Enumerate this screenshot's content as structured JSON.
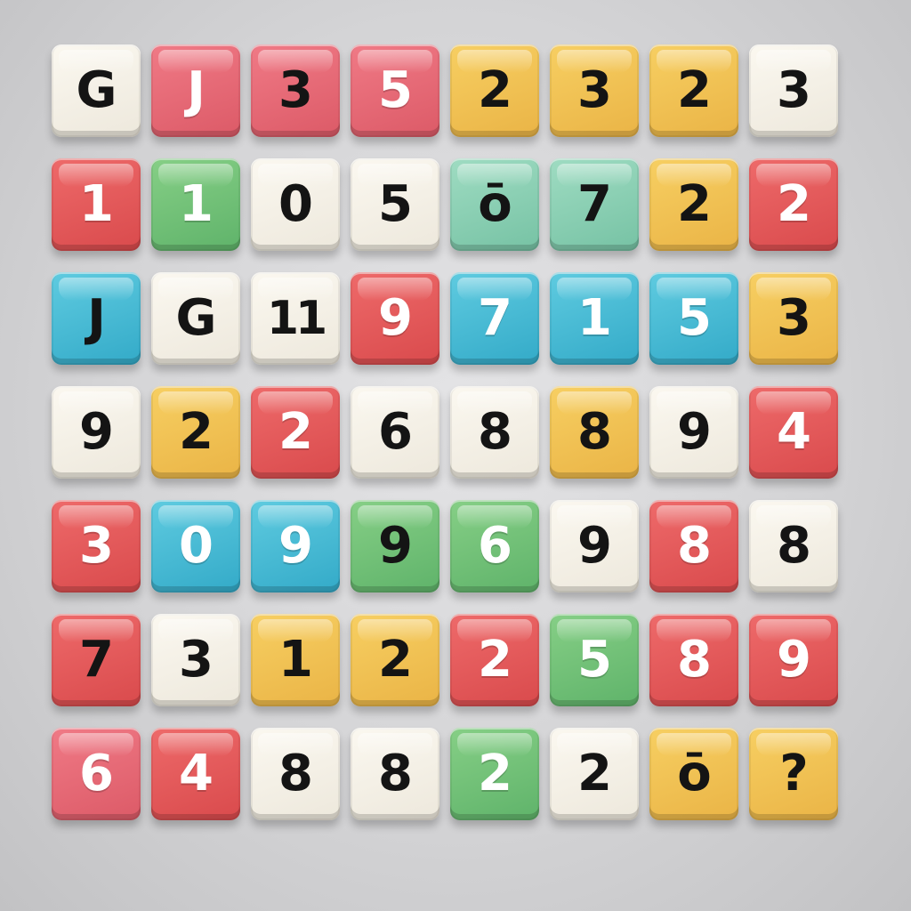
{
  "tile_colors": {
    "white": "#f4f0e6",
    "red": "#e35a5b",
    "pink": "#e66a77",
    "yellow": "#f0c354",
    "green": "#73c178",
    "mint": "#8acfb3",
    "blue": "#49bbd4",
    "ink_dark": "#141414",
    "ink_light": "#ffffff"
  },
  "rows": [
    [
      {
        "char": "G",
        "color": "white",
        "ink": "dark"
      },
      {
        "char": "J",
        "color": "pink",
        "ink": "light"
      },
      {
        "char": "3",
        "color": "pink",
        "ink": "dark"
      },
      {
        "char": "5",
        "color": "pink",
        "ink": "light"
      },
      {
        "char": "2",
        "color": "yellow",
        "ink": "dark"
      },
      {
        "char": "3",
        "color": "yellow",
        "ink": "dark"
      },
      {
        "char": "2",
        "color": "yellow",
        "ink": "dark"
      },
      {
        "char": "3",
        "color": "white",
        "ink": "dark"
      }
    ],
    [
      {
        "char": "1",
        "color": "red",
        "ink": "light"
      },
      {
        "char": "1",
        "color": "green",
        "ink": "light"
      },
      {
        "char": "0",
        "color": "white",
        "ink": "dark"
      },
      {
        "char": "5",
        "color": "white",
        "ink": "dark"
      },
      {
        "char": "ō",
        "color": "mint",
        "ink": "dark"
      },
      {
        "char": "7",
        "color": "mint",
        "ink": "dark"
      },
      {
        "char": "2",
        "color": "yellow",
        "ink": "dark"
      },
      {
        "char": "2",
        "color": "red",
        "ink": "light"
      }
    ],
    [
      {
        "char": "J",
        "color": "blue",
        "ink": "dark"
      },
      {
        "char": "G",
        "color": "white",
        "ink": "dark"
      },
      {
        "char": "11",
        "color": "white",
        "ink": "dark"
      },
      {
        "char": "9",
        "color": "red",
        "ink": "light"
      },
      {
        "char": "7",
        "color": "blue",
        "ink": "light"
      },
      {
        "char": "1",
        "color": "blue",
        "ink": "light"
      },
      {
        "char": "5",
        "color": "blue",
        "ink": "light"
      },
      {
        "char": "3",
        "color": "yellow",
        "ink": "dark"
      }
    ],
    [
      {
        "char": "9",
        "color": "white",
        "ink": "dark"
      },
      {
        "char": "2",
        "color": "yellow",
        "ink": "dark"
      },
      {
        "char": "2",
        "color": "red",
        "ink": "light"
      },
      {
        "char": "6",
        "color": "white",
        "ink": "dark"
      },
      {
        "char": "8",
        "color": "white",
        "ink": "dark"
      },
      {
        "char": "8",
        "color": "yellow",
        "ink": "dark"
      },
      {
        "char": "9",
        "color": "white",
        "ink": "dark"
      },
      {
        "char": "4",
        "color": "red",
        "ink": "light"
      }
    ],
    [
      {
        "char": "3",
        "color": "red",
        "ink": "light"
      },
      {
        "char": "0",
        "color": "blue",
        "ink": "light"
      },
      {
        "char": "9",
        "color": "blue",
        "ink": "light"
      },
      {
        "char": "9",
        "color": "green",
        "ink": "dark"
      },
      {
        "char": "6",
        "color": "green",
        "ink": "light"
      },
      {
        "char": "9",
        "color": "white",
        "ink": "dark"
      },
      {
        "char": "8",
        "color": "red",
        "ink": "light"
      },
      {
        "char": "8",
        "color": "white",
        "ink": "dark"
      }
    ],
    [
      {
        "char": "7",
        "color": "red",
        "ink": "dark"
      },
      {
        "char": "3",
        "color": "white",
        "ink": "dark"
      },
      {
        "char": "1",
        "color": "yellow",
        "ink": "dark"
      },
      {
        "char": "2",
        "color": "yellow",
        "ink": "dark"
      },
      {
        "char": "2",
        "color": "red",
        "ink": "light"
      },
      {
        "char": "5",
        "color": "green",
        "ink": "light"
      },
      {
        "char": "8",
        "color": "red",
        "ink": "light"
      },
      {
        "char": "9",
        "color": "red",
        "ink": "light"
      }
    ],
    [
      {
        "char": "6",
        "color": "pink",
        "ink": "light"
      },
      {
        "char": "4",
        "color": "red",
        "ink": "light"
      },
      {
        "char": "8",
        "color": "white",
        "ink": "dark"
      },
      {
        "char": "8",
        "color": "white",
        "ink": "dark"
      },
      {
        "char": "2",
        "color": "green",
        "ink": "light"
      },
      {
        "char": "2",
        "color": "white",
        "ink": "dark"
      },
      {
        "char": "ō",
        "color": "yellow",
        "ink": "dark"
      },
      {
        "char": "?",
        "color": "yellow",
        "ink": "dark"
      }
    ]
  ]
}
